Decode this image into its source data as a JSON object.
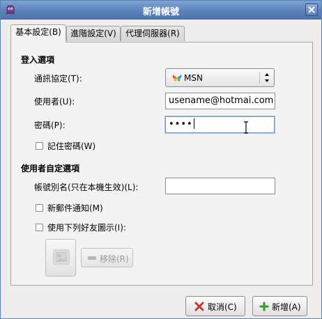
{
  "window": {
    "title": "新增帳號"
  },
  "tabs": [
    {
      "label": "基本設定(B)",
      "active": true
    },
    {
      "label": "進階設定(V)",
      "active": false
    },
    {
      "label": "代理伺服器(R)",
      "active": false
    }
  ],
  "login_options": {
    "section_title": "登入選項",
    "protocol_label": "通訊協定(T):",
    "protocol_value": "MSN",
    "username_label": "使用者(U):",
    "username_value": "usename@hotmai.com",
    "password_label": "密碼(P):",
    "password_value": "••••",
    "remember_password_label": "記住密碼(W)"
  },
  "user_options": {
    "section_title": "使用者自定選項",
    "alias_label": "帳號別名(只在本機生效)(L):",
    "alias_value": "",
    "new_mail_label": "新郵件通知(M)",
    "buddy_icon_label": "使用下列好友圖示(I):",
    "remove_label": "移除(R)"
  },
  "buttons": {
    "cancel_label": "取消(C)",
    "add_label": "新增(A)"
  },
  "colors": {
    "titlebar": "#5b82bb",
    "window_bg": "#ededed",
    "cancel_icon": "#c0392b",
    "add_icon": "#3f9a2f"
  },
  "icons": {
    "app": "pidgin-icon",
    "close": "close-icon",
    "protocol": "msn-butterfly-icon",
    "buddy_image": "image-placeholder-icon",
    "remove": "remove-icon",
    "cancel": "cancel-x-icon",
    "add": "plus-icon"
  }
}
